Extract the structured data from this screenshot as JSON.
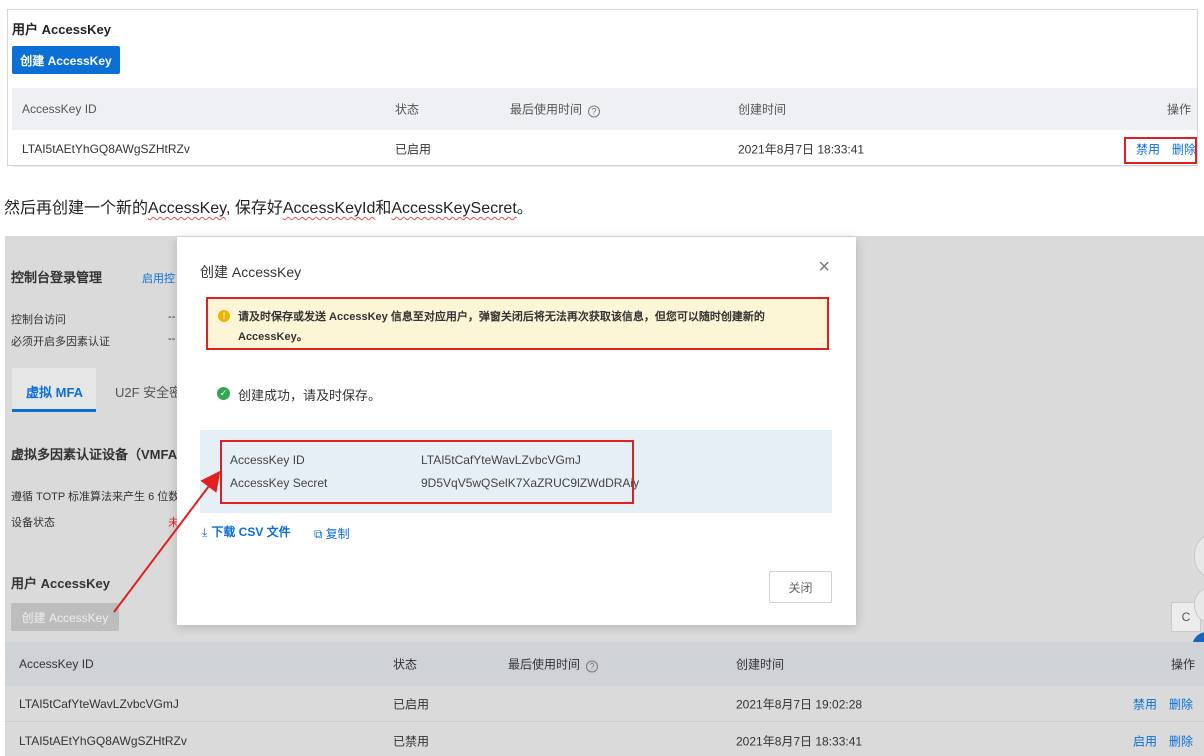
{
  "top": {
    "title": "用户 AccessKey",
    "create_button": "创建 AccessKey",
    "columns": [
      "AccessKey ID",
      "状态",
      "最后使用时间",
      "创建时间",
      "操作"
    ],
    "help_icon": "?",
    "row": {
      "id": "LTAI5tAEtYhGQ8AWgSZHtRZv",
      "status": "已启用",
      "created": "2021年8月7日 18:33:41",
      "action1": "禁用",
      "action2": "删除"
    }
  },
  "caption": {
    "prefix": "然后再创建一个新的",
    "ak": "AccessKey",
    "mid": ", 保存好",
    "akid": "AccessKeyId",
    "and": "和",
    "aksecret": "AccessKeySecret",
    "end": "。"
  },
  "console": {
    "login_title": "控制台登录管理",
    "login_link": "启用控",
    "console_access": "控制台访问",
    "mfa_required": "必须开启多因素认证",
    "dash": "--",
    "tab_virtual": "虚拟 MFA",
    "tab_u2f": "U2F 安全密",
    "vmfa_title": "虚拟多因素认证设备（VMFA",
    "vmfa_desc": "遵循 TOTP 标准算法来产生 6 位数",
    "device_status": "设备状态",
    "device_status_val": "未",
    "ak_title": "用户 AccessKey",
    "create_button": "创建 AccessKey",
    "columns": [
      "AccessKey ID",
      "状态",
      "最后使用时间",
      "创建时间",
      "操作"
    ],
    "help_icon": "?",
    "refresh_icon": "C",
    "rows": [
      {
        "id": "LTAI5tCafYteWavLZvbcVGmJ",
        "status": "已启用",
        "created": "2021年8月7日 19:02:28",
        "action1": "禁用",
        "action2": "删除"
      },
      {
        "id": "LTAI5tAEtYhGQ8AWgSZHtRZv",
        "status": "已禁用",
        "created": "2021年8月7日 18:33:41",
        "action1": "启用",
        "action2": "删除"
      }
    ]
  },
  "modal": {
    "title": "创建 AccessKey",
    "close_glyph": "×",
    "warning": "请及时保存或发送 AccessKey 信息至对应用户，弹窗关闭后将无法再次获取该信息，但您可以随时创建新的 AccessKey。",
    "warning_icon": "!",
    "success_icon": "✓",
    "success": "创建成功，请及时保存。",
    "key_id_label": "AccessKey ID",
    "key_id_value": "LTAI5tCafYteWavLZvbcVGmJ",
    "key_secret_label": "AccessKey Secret",
    "key_secret_value": "9D5VqV5wQSelK7XaZRUC9lZWdDRAiy",
    "download_icon": "⤓",
    "download": "下载 CSV 文件",
    "copy_icon": "⧉",
    "copy": "复制",
    "close_button": "关闭"
  },
  "colors": {
    "primary": "#0b6fd6",
    "annotation_red": "#e02020",
    "warning_bg": "#fdf6d6",
    "success": "#32a852"
  }
}
